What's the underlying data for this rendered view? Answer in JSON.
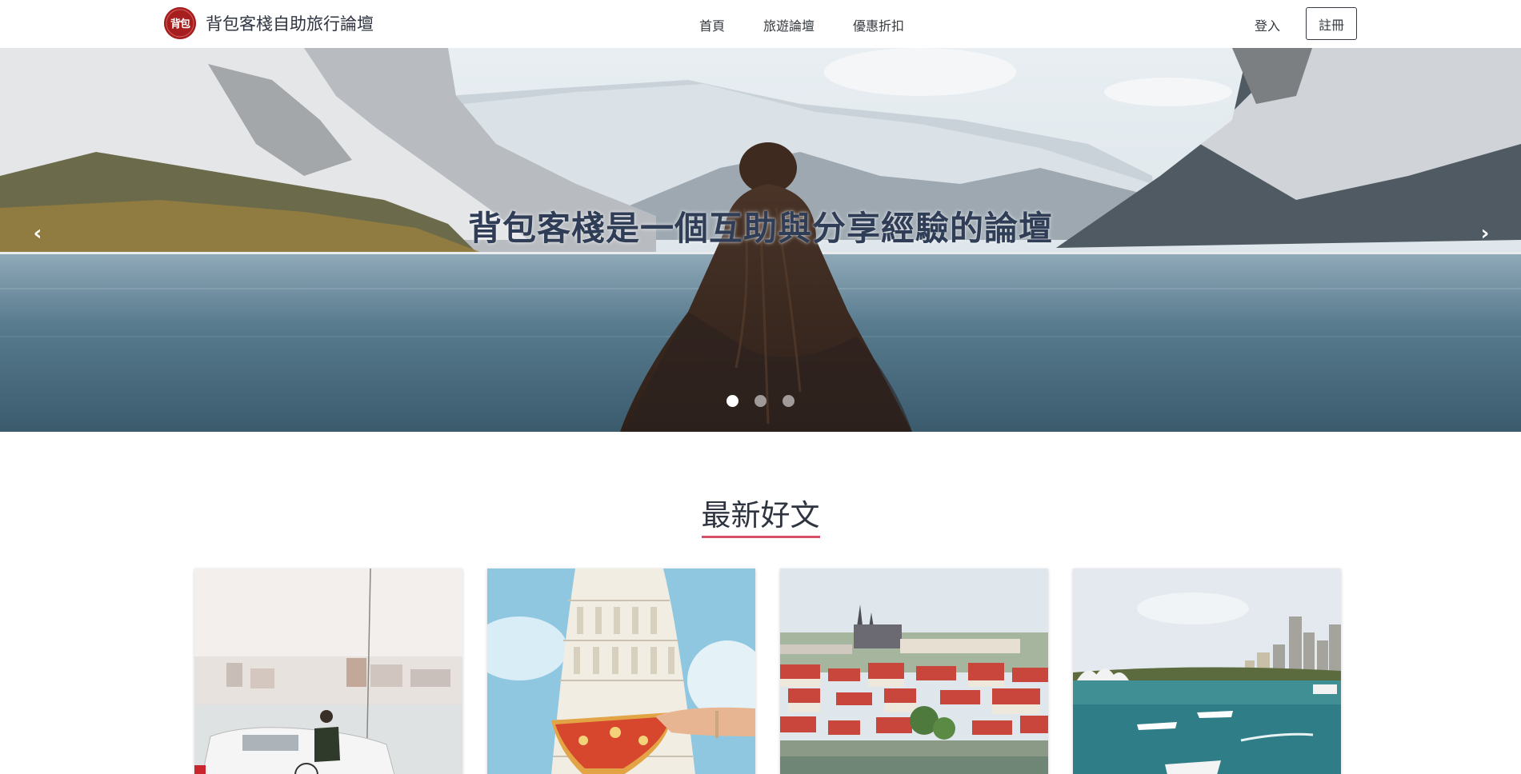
{
  "navbar": {
    "brand": {
      "logo_icon": "backpacker-inn-logo-icon",
      "logo_text": "背包客棧",
      "name": "背包客棧自助旅行論壇"
    },
    "links": [
      {
        "label": "首頁"
      },
      {
        "label": "旅遊論壇"
      },
      {
        "label": "優惠折扣"
      }
    ],
    "login_label": "登入",
    "signup_label": "註冊"
  },
  "hero": {
    "caption": "背包客棧是一個互助與分享經驗的論壇",
    "prev_icon": "chevron-left-icon",
    "next_icon": "chevron-right-icon",
    "slide_count": 3,
    "active_slide": 1
  },
  "section": {
    "title": "最新好文",
    "accent_color": "#d84f6a"
  },
  "cards": [
    {
      "image": "bicycle-rider-waterfront-photo"
    },
    {
      "image": "leaning-tower-pizza-photo"
    },
    {
      "image": "prague-castle-city-photo"
    },
    {
      "image": "sydney-harbour-photo"
    }
  ],
  "colors": {
    "text_dark": "#2e3440",
    "brand_red": "#a61e1e",
    "hero_caption": "#2f3e56"
  }
}
